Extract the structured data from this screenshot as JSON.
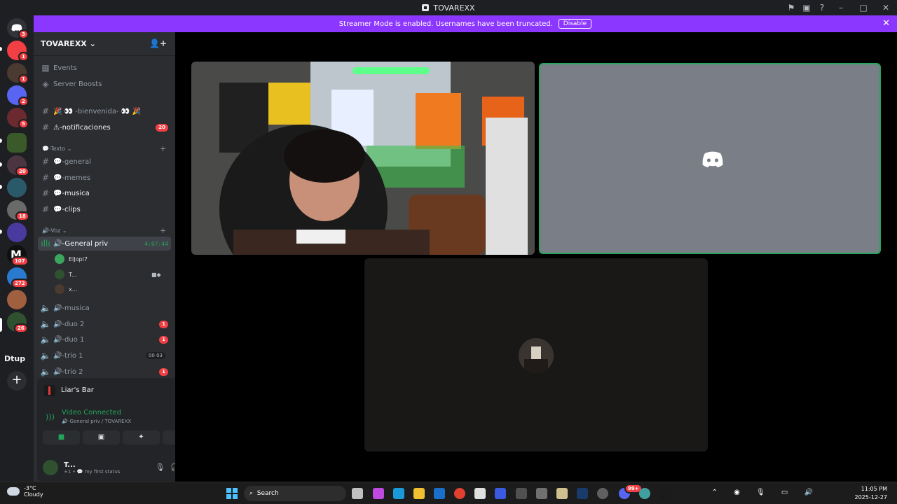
{
  "window": {
    "title": "TOVAREXX"
  },
  "banner": {
    "text": "Streamer Mode is enabled. Usernames have been truncated.",
    "button": "Disable"
  },
  "rail": {
    "badges": [
      "3",
      "1",
      "1",
      "2",
      "5",
      "20",
      "18",
      "107",
      "272",
      "26"
    ],
    "folder_label": "Dtup",
    "colors": {
      "discord": "#5865f2",
      "red": "#f23f43"
    }
  },
  "server": {
    "name": "TOVAREXX"
  },
  "sidebar": {
    "events": "Events",
    "boosts": "Server Boosts",
    "channels_top": [
      {
        "name": "🎉 👀 -bienvenida- 👀 🎉",
        "count": ""
      },
      {
        "name": "⚠-notificaciones",
        "count": "20"
      }
    ],
    "text_category": "💬-Texto",
    "text_channels": [
      "💬-general",
      "💬-memes",
      "💬-musica",
      "💬-clips"
    ],
    "voice_category": "🔊-Voz",
    "active_voice": {
      "name": "🔊-General priv",
      "timer": "4:07:44"
    },
    "members": [
      "ElJopi7",
      "T...",
      "x..."
    ],
    "voice_channels": [
      {
        "name": "🔊-musica",
        "count": ""
      },
      {
        "name": "🔊-duo 2",
        "count": "1"
      },
      {
        "name": "🔊-duo 1",
        "count": "1"
      },
      {
        "name": "🔊-trio 1",
        "count": "00 03"
      },
      {
        "name": "🔊-trio 2",
        "count": "1"
      }
    ]
  },
  "panel": {
    "activity": "Liar's Bar",
    "status": "Video Connected",
    "location": "🔊-General priv / TOVAREXX",
    "user": {
      "name": "T...",
      "status": "+1 • 💬 my first status"
    }
  },
  "stage": {
    "border_color": "#23a55a",
    "placeholder_bg": "#7a7f87"
  },
  "taskbar": {
    "weather_temp": "-3°C",
    "weather_desc": "Cloudy",
    "search_placeholder": "Search",
    "time": "11:05 PM",
    "date": "2025-12-27",
    "tray_badge": "99+"
  }
}
